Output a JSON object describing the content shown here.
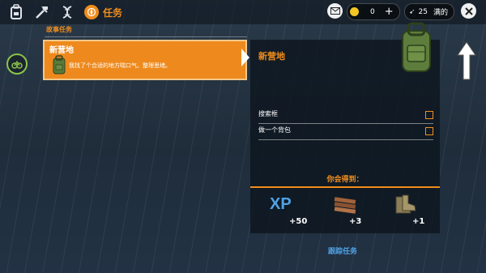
{
  "topbar": {
    "active_tab_label": "任务",
    "coins": "0",
    "ammo": "25",
    "full_label": "满的"
  },
  "quests": {
    "section_title": "故事任务",
    "card": {
      "title": "新营地",
      "description": "我找了个合适的地方喘口气。整理思绪。"
    }
  },
  "detail": {
    "title": "新营地",
    "tasks": [
      {
        "label": "搜索框"
      },
      {
        "label": "做一个背包"
      }
    ],
    "reward_title": "你会得到：",
    "rewards": [
      {
        "icon": "xp-icon",
        "amount": "+50",
        "icon_text": "XP"
      },
      {
        "icon": "wood-planks-icon",
        "amount": "+3"
      },
      {
        "icon": "boots-icon",
        "amount": "+1"
      }
    ],
    "track_label": "跟踪任务"
  },
  "colors": {
    "accent": "#f08d1c",
    "link": "#4fa3e6",
    "progress_green": "#8bc34a"
  }
}
